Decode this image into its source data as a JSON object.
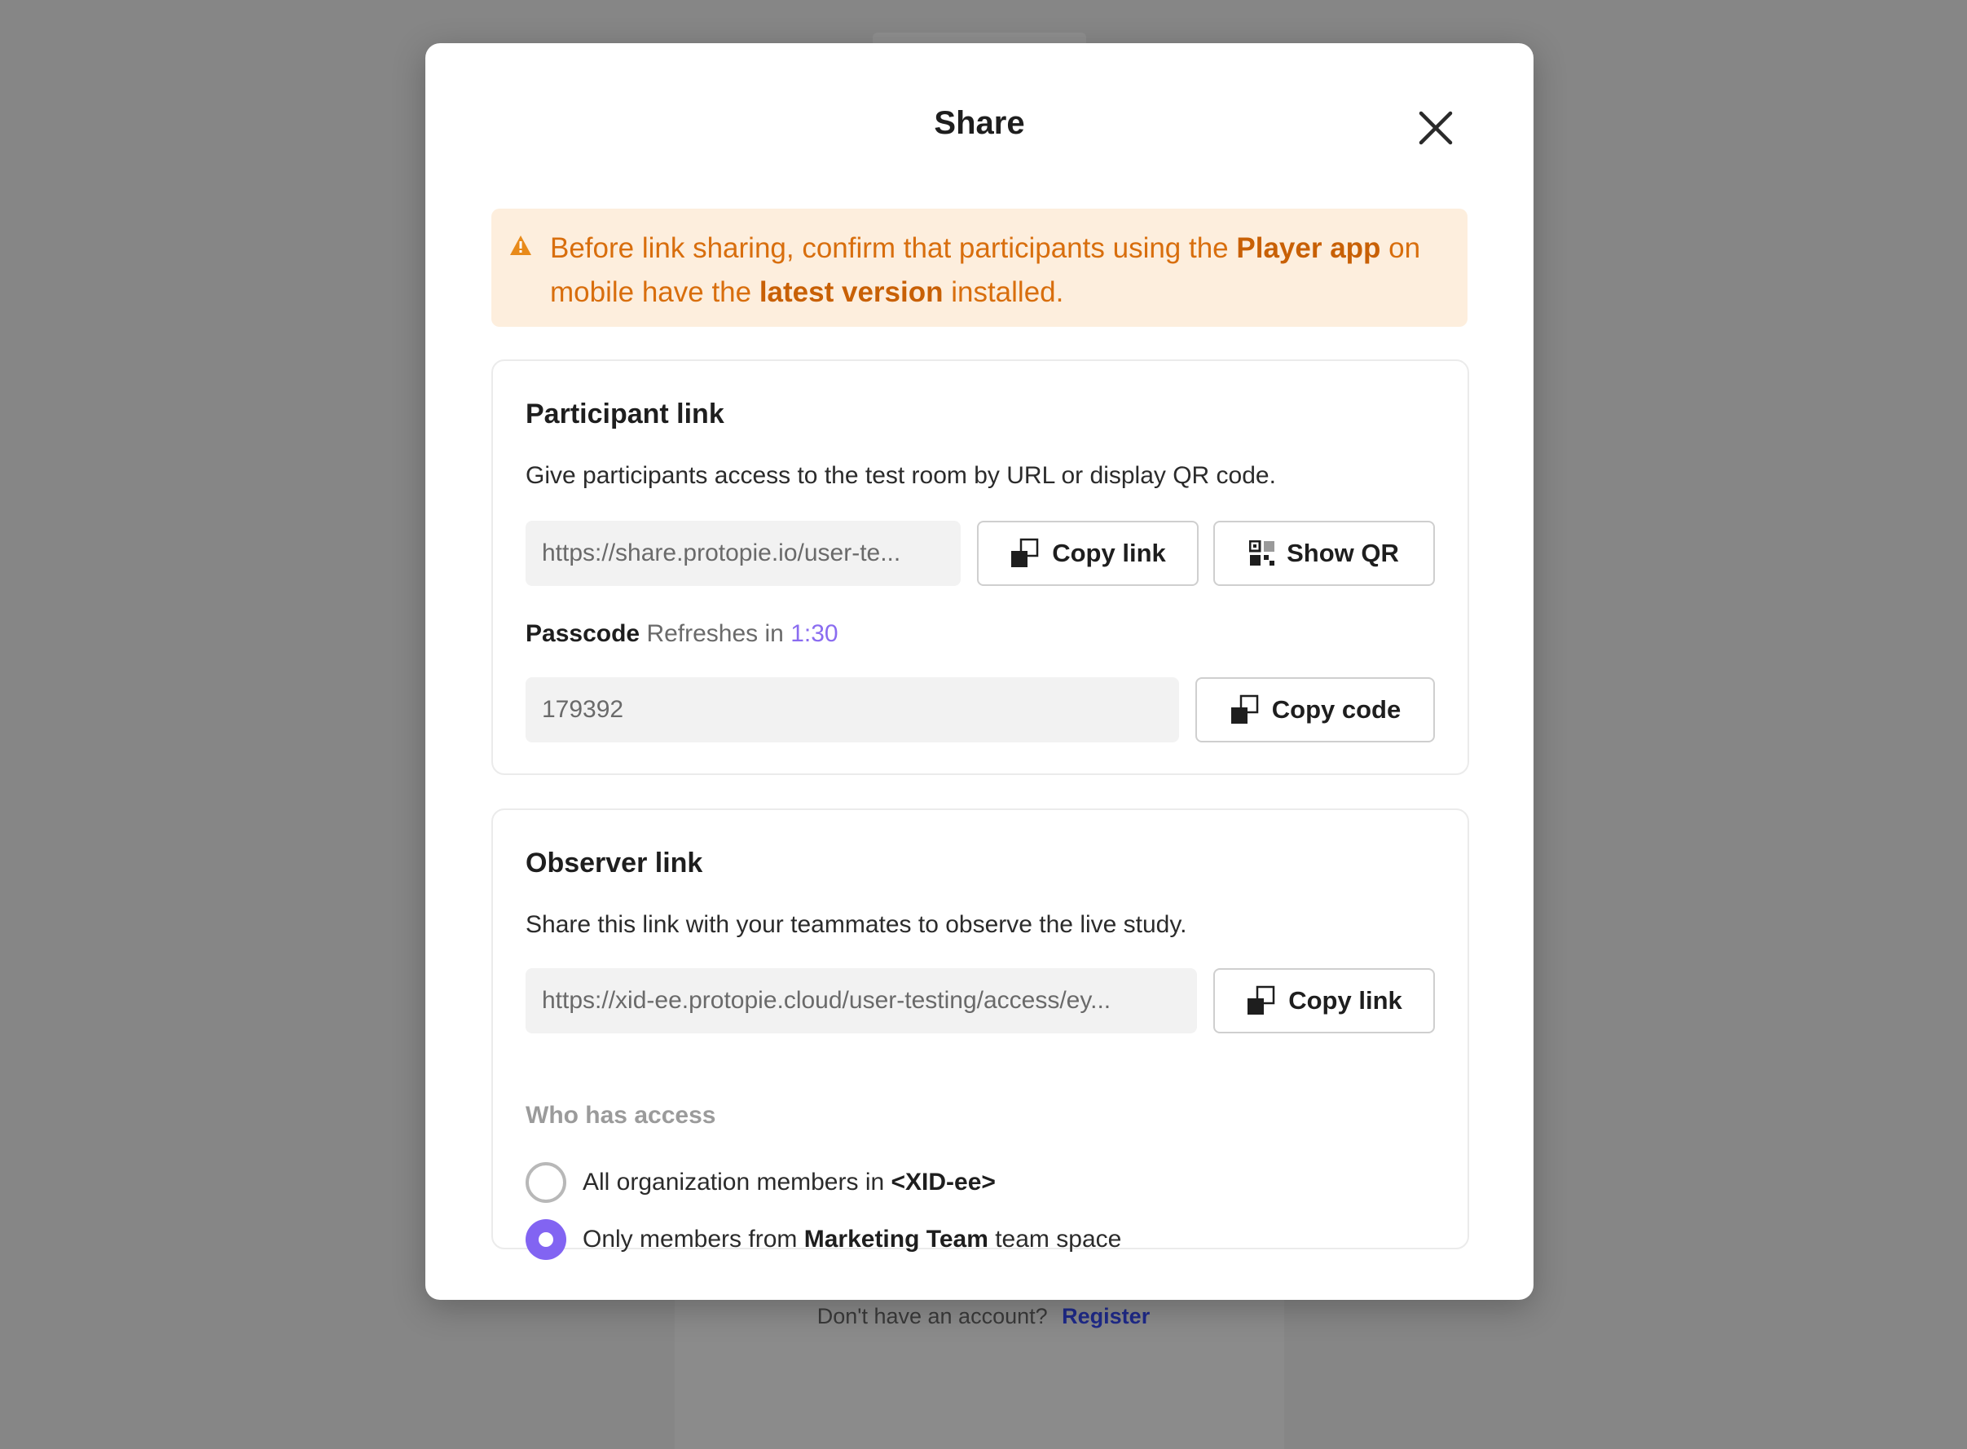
{
  "background": {
    "footer_prompt": "Don't have an account?",
    "footer_link": "Register"
  },
  "modal": {
    "title": "Share",
    "close_icon": "close-icon"
  },
  "warning": {
    "icon": "warning-triangle-icon",
    "text_before": "Before link sharing, confirm that participants using the ",
    "bold_1": "Player app",
    "text_middle": " on mobile have the ",
    "bold_2": "latest version",
    "text_after": " installed."
  },
  "participant": {
    "title": "Participant link",
    "description": "Give participants access to the test room by URL or display QR code.",
    "url": "https://share.protopie.io/user-te...",
    "copy_link_label": "Copy link",
    "show_qr_label": "Show QR",
    "passcode_label": "Passcode",
    "refresh_text": "Refreshes in",
    "refresh_timer": "1:30",
    "passcode_value": "179392",
    "copy_code_label": "Copy code"
  },
  "observer": {
    "title": "Observer link",
    "description": "Share this link with your teammates to observe the live study.",
    "url": "https://xid-ee.protopie.cloud/user-testing/access/ey...",
    "copy_link_label": "Copy link",
    "access_label": "Who has access",
    "options": [
      {
        "text": "All organization members in ",
        "bold": "<XID-ee>",
        "suffix": "",
        "selected": false
      },
      {
        "text": "Only members from ",
        "bold": "Marketing Team",
        "suffix": " team space",
        "selected": true
      }
    ]
  },
  "colors": {
    "accent": "#8264f2",
    "warning_bg": "#fdeedd",
    "warning_text": "#d86e0d",
    "overlay": "#868686"
  }
}
